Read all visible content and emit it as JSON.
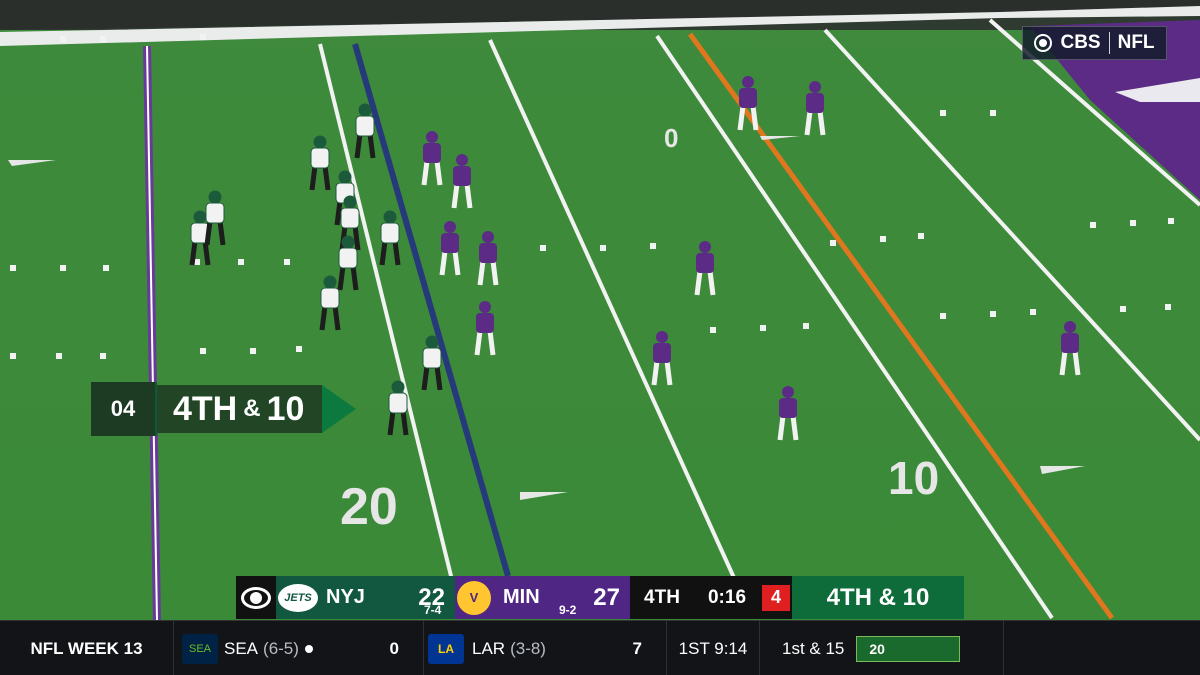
{
  "network": {
    "bug_text": "CBS",
    "league_text": "NFL",
    "icon": "cbs-eye-icon"
  },
  "field_numbers": {
    "twenty": "20",
    "ten": "10",
    "zero": "0"
  },
  "down_marker": {
    "number": "04",
    "down": "4TH",
    "amp": "&",
    "distance": "10"
  },
  "scorebug": {
    "away": {
      "abbr": "NYJ",
      "record": "7-4",
      "score": "22",
      "logo": "jets-logo",
      "color": "#125740"
    },
    "home": {
      "abbr": "MIN",
      "record": "9-2",
      "score": "27",
      "logo": "vikings-logo",
      "color": "#4f2683"
    },
    "quarter": "4TH",
    "clock": "0:16",
    "play_clock": "4",
    "down_distance": "4TH & 10"
  },
  "ticker": {
    "label": "NFL WEEK 13",
    "team1": {
      "abbr": "SEA",
      "record": "(6-5)",
      "score": "0",
      "possession": true
    },
    "team2": {
      "abbr": "LAR",
      "record": "(3-8)",
      "score": "7"
    },
    "game_clock": "1ST 9:14",
    "down_distance": "1st & 15",
    "yard_line": "20"
  }
}
